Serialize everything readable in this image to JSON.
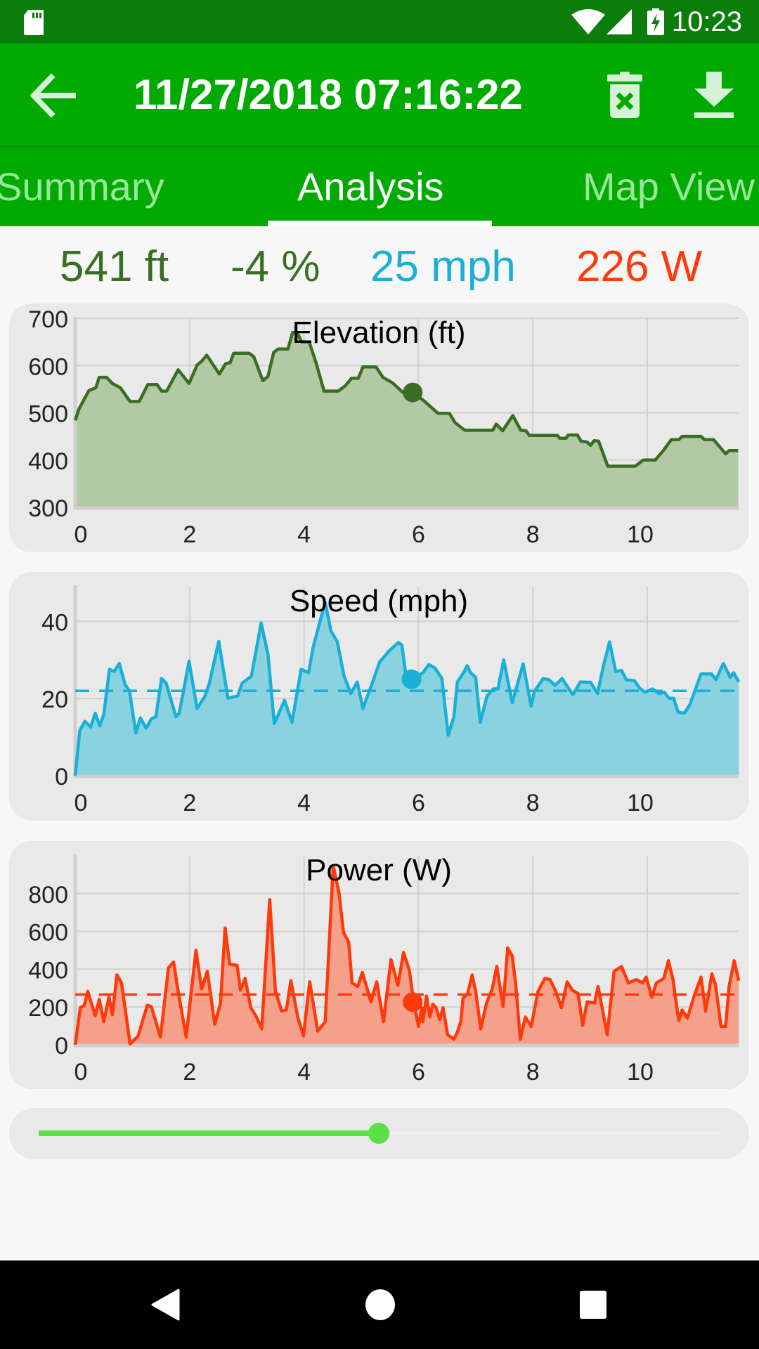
{
  "status_bar": {
    "time": "10:23",
    "icons": [
      "sd-card-icon",
      "wifi-icon",
      "cell-signal-icon",
      "battery-charging-icon"
    ]
  },
  "app_bar": {
    "title": "11/27/2018 07:16:22",
    "back_icon": "arrow-left-icon",
    "actions": [
      {
        "name": "delete",
        "icon": "trash-x-icon"
      },
      {
        "name": "export",
        "icon": "download-icon"
      }
    ]
  },
  "tabs": [
    {
      "label": "Summary",
      "active": false
    },
    {
      "label": "Analysis",
      "active": true
    },
    {
      "label": "Map View",
      "active": false
    }
  ],
  "stats": {
    "elevation": "541 ft",
    "grade": "-4 %",
    "speed": "25 mph",
    "power": "226 W"
  },
  "colors": {
    "app_bar": "#00aa00",
    "status_bar": "#0a7d0a",
    "elevation": "#3a6e22",
    "elevation_fill": "#b3c9a6",
    "speed": "#1aafd6",
    "speed_fill": "#8ad2e0",
    "power": "#ff3a0a",
    "power_fill": "#f4a08a",
    "slider": "#5ddf4a"
  },
  "slider": {
    "progress": 0.5
  },
  "chart_data": [
    {
      "type": "area",
      "title": "Elevation (ft)",
      "xlabel": "",
      "ylabel": "",
      "xlim": [
        0,
        11.6
      ],
      "ylim": [
        300,
        700
      ],
      "xticks": [
        0,
        2,
        4,
        6,
        8,
        10
      ],
      "yticks": [
        300,
        400,
        500,
        600,
        700
      ],
      "ytick_labels": [
        "300",
        "400",
        "500",
        "600",
        "700"
      ],
      "grid": true,
      "cursor": {
        "x": 5.9,
        "y": 543
      },
      "x": [
        0,
        0.07,
        0.24,
        0.36,
        0.42,
        0.55,
        0.65,
        0.79,
        0.96,
        1.12,
        1.27,
        1.43,
        1.51,
        1.6,
        1.8,
        1.99,
        2.13,
        2.21,
        2.3,
        2.52,
        2.63,
        2.71,
        2.77,
        3.04,
        3.12,
        3.28,
        3.37,
        3.47,
        3.55,
        3.72,
        3.8,
        3.88,
        3.96,
        4.09,
        4.21,
        4.35,
        4.6,
        4.72,
        4.83,
        4.95,
        5.03,
        5.26,
        5.38,
        5.55,
        5.73,
        5.91,
        6.11,
        6.34,
        6.54,
        6.64,
        6.81,
        7.3,
        7.36,
        7.47,
        7.65,
        7.79,
        7.88,
        7.94,
        8.43,
        8.47,
        8.58,
        8.62,
        8.78,
        8.84,
        8.95,
        9.01,
        9.07,
        9.15,
        9.31,
        9.79,
        9.93,
        10.14,
        10.28,
        10.42,
        10.55,
        10.61,
        10.94,
        11.0,
        11.16,
        11.37,
        11.43,
        11.59
      ],
      "values": [
        484,
        509,
        547,
        553,
        575,
        575,
        562,
        553,
        524,
        524,
        560,
        560,
        546,
        546,
        591,
        562,
        601,
        609,
        622,
        582,
        604,
        606,
        626,
        626,
        619,
        568,
        577,
        628,
        635,
        635,
        670,
        670,
        650,
        650,
        606,
        546,
        546,
        557,
        573,
        573,
        597,
        597,
        575,
        563,
        543,
        543,
        524,
        499,
        499,
        479,
        463,
        463,
        476,
        462,
        494,
        463,
        462,
        452,
        452,
        446,
        446,
        453,
        453,
        440,
        438,
        431,
        441,
        440,
        387,
        387,
        400,
        400,
        420,
        443,
        443,
        450,
        450,
        443,
        443,
        413,
        420,
        420
      ]
    },
    {
      "type": "area",
      "title": "Speed (mph)",
      "xlabel": "",
      "ylabel": "",
      "xlim": [
        0,
        11.6
      ],
      "ylim": [
        0,
        49
      ],
      "xticks": [
        0,
        2,
        4,
        6,
        8,
        10
      ],
      "yticks": [
        0,
        20,
        40
      ],
      "ytick_labels": [
        "0",
        "20",
        "40"
      ],
      "grid": true,
      "average": 22,
      "cursor": {
        "x": 5.88,
        "y": 25
      },
      "x": [
        0,
        0.08,
        0.17,
        0.27,
        0.35,
        0.43,
        0.5,
        0.6,
        0.68,
        0.77,
        0.87,
        0.95,
        1.06,
        1.14,
        1.24,
        1.33,
        1.41,
        1.51,
        1.59,
        1.76,
        1.82,
        1.99,
        2.13,
        2.26,
        2.34,
        2.51,
        2.67,
        2.84,
        2.92,
        3.08,
        3.25,
        3.37,
        3.48,
        3.66,
        3.79,
        3.95,
        4.08,
        4.16,
        4.37,
        4.47,
        4.58,
        4.7,
        4.82,
        4.93,
        5.03,
        5.2,
        5.32,
        5.49,
        5.65,
        5.71,
        5.78,
        5.9,
        6.08,
        6.18,
        6.29,
        6.41,
        6.52,
        6.62,
        6.68,
        6.79,
        6.85,
        6.91,
        7.0,
        7.08,
        7.2,
        7.31,
        7.39,
        7.49,
        7.64,
        7.83,
        7.97,
        8.03,
        8.18,
        8.28,
        8.39,
        8.51,
        8.7,
        8.83,
        9.01,
        9.13,
        9.24,
        9.34,
        9.45,
        9.55,
        9.63,
        9.78,
        9.86,
        9.96,
        10.09,
        10.21,
        10.3,
        10.38,
        10.46,
        10.54,
        10.65,
        10.75,
        10.94,
        11.12,
        11.2,
        11.33,
        11.45,
        11.51,
        11.6
      ],
      "values": [
        0,
        11.7,
        14.1,
        12.6,
        16.2,
        12.9,
        15.9,
        27.6,
        27,
        29.1,
        23.7,
        21.9,
        11.1,
        15,
        12.3,
        14.7,
        15.3,
        25.2,
        24,
        15.3,
        16.2,
        29.7,
        17.4,
        20.4,
        23.7,
        34.8,
        20.1,
        20.7,
        24,
        25.8,
        39.6,
        31.5,
        13.5,
        19.5,
        13.8,
        27.6,
        26.7,
        33.3,
        45,
        37.5,
        34.8,
        25.8,
        21.3,
        24.3,
        17.4,
        24.3,
        29.4,
        32.4,
        34.5,
        33.9,
        26.1,
        24.9,
        26.7,
        28.8,
        27.9,
        25.2,
        10.5,
        15.3,
        24.3,
        26.7,
        28.5,
        26.7,
        25.5,
        13.8,
        20.7,
        22.5,
        22.5,
        30,
        18.9,
        29,
        18,
        21.9,
        25.2,
        24.9,
        23.4,
        25.2,
        21,
        24.3,
        24.2,
        21.3,
        28.8,
        34.7,
        27,
        27.3,
        24.9,
        24.6,
        22.8,
        21.6,
        22.5,
        21.3,
        21.6,
        20.1,
        20.1,
        16.5,
        16.2,
        18.6,
        26.4,
        26.4,
        24.9,
        29.1,
        25.5,
        26.7,
        24.3
      ]
    },
    {
      "type": "area",
      "title": "Power (W)",
      "xlabel": "",
      "ylabel": "",
      "xlim": [
        0,
        11.6
      ],
      "ylim": [
        0,
        1000
      ],
      "xticks": [
        0,
        2,
        4,
        6,
        8,
        10
      ],
      "yticks": [
        0,
        200,
        400,
        600,
        800
      ],
      "ytick_labels": [
        "0",
        "200",
        "400",
        "600",
        "800"
      ],
      "grid": true,
      "average": 266,
      "cursor": {
        "x": 5.9,
        "y": 226
      },
      "x": [
        0,
        0.09,
        0.16,
        0.22,
        0.35,
        0.42,
        0.5,
        0.59,
        0.65,
        0.73,
        0.81,
        0.96,
        1.1,
        1.26,
        1.33,
        1.49,
        1.63,
        1.72,
        1.8,
        1.94,
        2.11,
        2.21,
        2.31,
        2.44,
        2.54,
        2.62,
        2.7,
        2.83,
        2.89,
        2.97,
        3.07,
        3.17,
        3.26,
        3.4,
        3.5,
        3.61,
        3.69,
        3.77,
        3.89,
        3.99,
        4.1,
        4.24,
        4.37,
        4.51,
        4.61,
        4.69,
        4.78,
        4.84,
        4.94,
        5.02,
        5.17,
        5.27,
        5.39,
        5.52,
        5.64,
        5.74,
        5.84,
        5.92,
        6.0,
        6.06,
        6.08,
        6.14,
        6.2,
        6.25,
        6.31,
        6.37,
        6.43,
        6.51,
        6.62,
        6.68,
        6.74,
        6.78,
        6.86,
        6.94,
        7.0,
        7.09,
        7.19,
        7.29,
        7.37,
        7.48,
        7.56,
        7.64,
        7.7,
        7.78,
        7.87,
        7.97,
        8.09,
        8.21,
        8.3,
        8.4,
        8.5,
        8.6,
        8.69,
        8.79,
        8.87,
        8.95,
        9.08,
        9.14,
        9.3,
        9.42,
        9.55,
        9.67,
        9.81,
        9.92,
        9.98,
        10.08,
        10.16,
        10.29,
        10.37,
        10.45,
        10.55,
        10.61,
        10.7,
        10.82,
        10.94,
        11.02,
        11.13,
        11.19,
        11.29,
        11.37,
        11.43,
        11.52,
        11.6
      ],
      "values": [
        0,
        196,
        209,
        283,
        153,
        240,
        122,
        252,
        159,
        370,
        327,
        4,
        47,
        209,
        202,
        41,
        407,
        438,
        283,
        41,
        500,
        296,
        389,
        109,
        221,
        618,
        426,
        420,
        289,
        351,
        196,
        147,
        84,
        768,
        283,
        178,
        184,
        339,
        147,
        47,
        333,
        72,
        122,
        948,
        805,
        594,
        544,
        327,
        308,
        383,
        227,
        333,
        122,
        451,
        314,
        488,
        395,
        221,
        97,
        196,
        122,
        258,
        147,
        215,
        196,
        134,
        196,
        53,
        29,
        66,
        122,
        246,
        271,
        370,
        283,
        84,
        221,
        296,
        414,
        202,
        513,
        469,
        320,
        29,
        147,
        97,
        283,
        351,
        345,
        283,
        196,
        333,
        289,
        271,
        103,
        227,
        221,
        308,
        53,
        389,
        414,
        327,
        345,
        327,
        358,
        252,
        327,
        351,
        445,
        345,
        128,
        184,
        140,
        258,
        358,
        178,
        376,
        320,
        97,
        97,
        308,
        445,
        339
      ]
    }
  ],
  "nav_bar": {
    "buttons": [
      "back-triangle-icon",
      "home-circle-icon",
      "recents-square-icon"
    ]
  }
}
